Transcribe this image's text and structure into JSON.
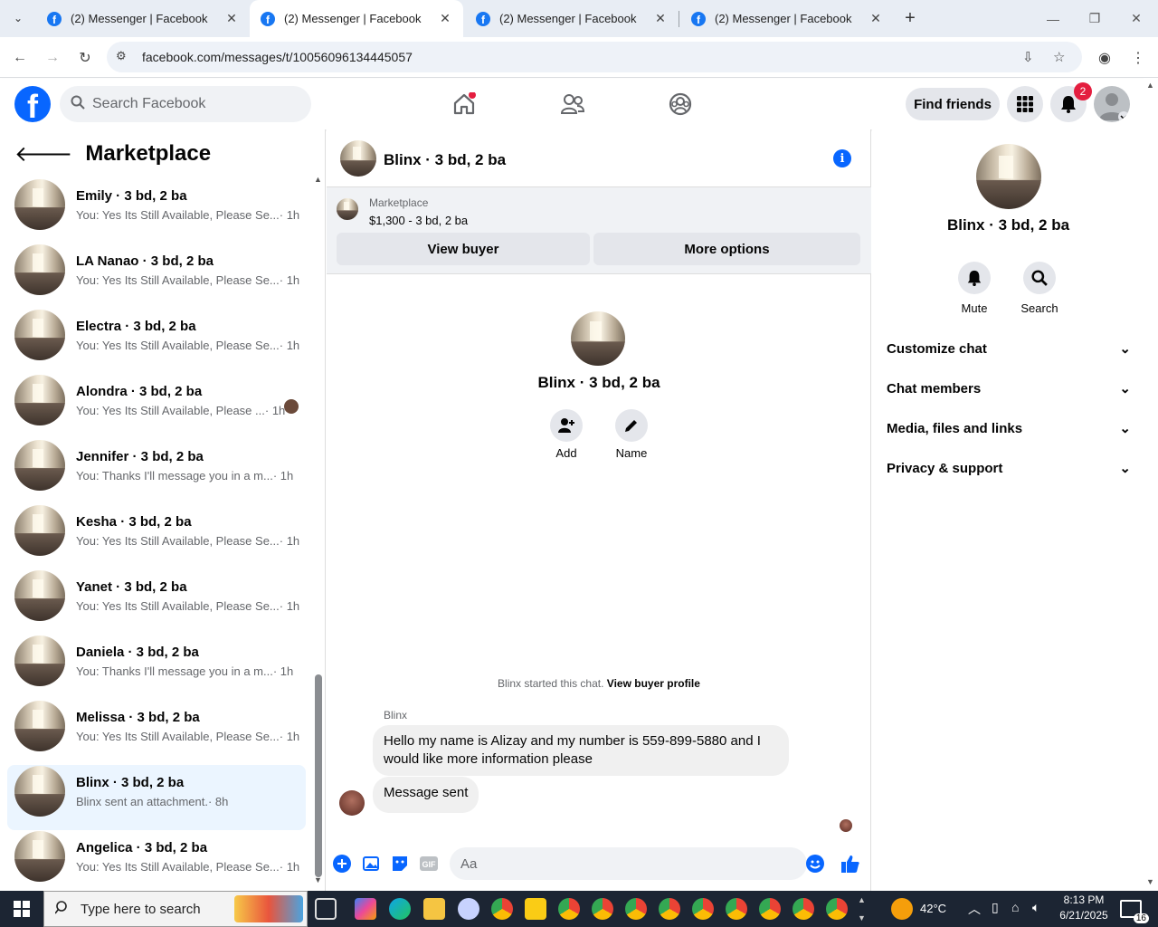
{
  "browser": {
    "tabs": [
      {
        "title": "(2) Messenger | Facebook",
        "active": false
      },
      {
        "title": "(2) Messenger | Facebook",
        "active": true
      },
      {
        "title": "(2) Messenger | Facebook",
        "active": false
      },
      {
        "title": "(2) Messenger | Facebook",
        "active": false
      }
    ],
    "url": "facebook.com/messages/t/10056096134445057"
  },
  "fb": {
    "search_placeholder": "Search Facebook",
    "find_friends": "Find friends",
    "notif_count": "2"
  },
  "left": {
    "title": "Marketplace",
    "conversations": [
      {
        "name": "Emily · 3 bd, 2 ba",
        "preview": "You: Yes Its Still Available, Please Se...",
        "time": " · 1h",
        "selected": false
      },
      {
        "name": "LA Nanao · 3 bd, 2 ba",
        "preview": "You: Yes Its Still Available, Please Se...",
        "time": " · 1h",
        "selected": false
      },
      {
        "name": "Electra · 3 bd, 2 ba",
        "preview": "You: Yes Its Still Available, Please Se...",
        "time": " · 1h",
        "selected": false
      },
      {
        "name": "Alondra · 3 bd, 2 ba",
        "preview": "You: Yes Its Still Available, Please ...",
        "time": " · 1h",
        "selected": false
      },
      {
        "name": "Jennifer · 3 bd, 2 ba",
        "preview": "You: Thanks I'll message you in a m...",
        "time": " · 1h",
        "selected": false
      },
      {
        "name": "Kesha · 3 bd, 2 ba",
        "preview": "You: Yes Its Still Available, Please Se...",
        "time": " · 1h",
        "selected": false
      },
      {
        "name": "Yanet · 3 bd, 2 ba",
        "preview": "You: Yes Its Still Available, Please Se...",
        "time": " · 1h",
        "selected": false
      },
      {
        "name": "Daniela · 3 bd, 2 ba",
        "preview": "You: Thanks I'll message you in a m...",
        "time": " · 1h",
        "selected": false
      },
      {
        "name": "Melissa · 3 bd, 2 ba",
        "preview": "You: Yes Its Still Available, Please Se...",
        "time": " · 1h",
        "selected": false
      },
      {
        "name": "Blinx · 3 bd, 2 ba",
        "preview": "Blinx sent an attachment.",
        "time": " · 8h",
        "selected": true
      },
      {
        "name": "Angelica · 3 bd, 2 ba",
        "preview": "You: Yes Its Still Available, Please Se...",
        "time": " · 1h",
        "selected": false
      }
    ]
  },
  "chat": {
    "title": "Blinx · 3 bd, 2 ba",
    "marketplace_label": "Marketplace",
    "listing": "$1,300 - 3 bd, 2 ba",
    "view_buyer": "View buyer",
    "more_options": "More options",
    "profile_name": "Blinx · 3 bd, 2 ba",
    "add_label": "Add",
    "name_label": "Name",
    "started_text": "Blinx started this chat.",
    "view_buyer_profile": "View buyer profile",
    "sender": "Blinx",
    "message1": "Hello my name is Alizay and my number is 559-899-5880 and I would like more information please",
    "message2": "Message sent",
    "input_placeholder": "Aa"
  },
  "right": {
    "name": "Blinx · 3 bd, 2 ba",
    "mute": "Mute",
    "search": "Search",
    "sections": [
      "Customize chat",
      "Chat members",
      "Media, files and links",
      "Privacy & support"
    ]
  },
  "taskbar": {
    "search_placeholder": "Type here to search",
    "temp": "42°C",
    "time": "8:13 PM",
    "date": "6/21/2025",
    "notif": "16"
  }
}
